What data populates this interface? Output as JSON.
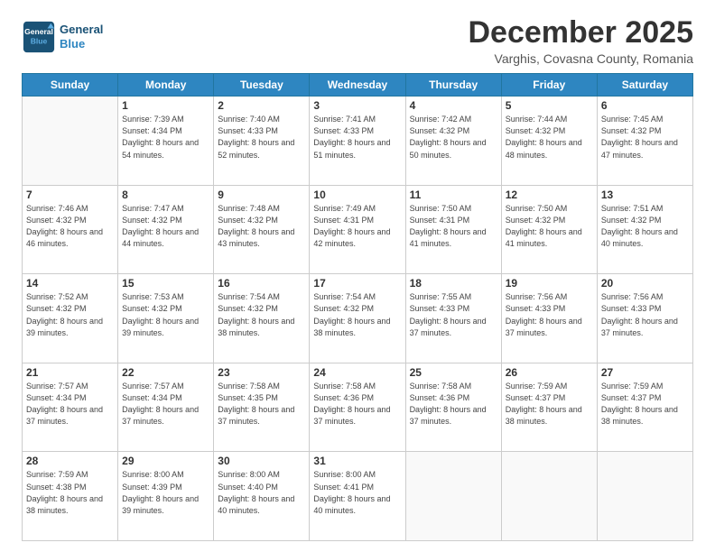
{
  "logo": {
    "line1": "General",
    "line2": "Blue"
  },
  "title": "December 2025",
  "subtitle": "Varghis, Covasna County, Romania",
  "days_of_week": [
    "Sunday",
    "Monday",
    "Tuesday",
    "Wednesday",
    "Thursday",
    "Friday",
    "Saturday"
  ],
  "weeks": [
    [
      {
        "day": "",
        "sunrise": "",
        "sunset": "",
        "daylight": ""
      },
      {
        "day": "1",
        "sunrise": "7:39 AM",
        "sunset": "4:34 PM",
        "daylight": "8 hours and 54 minutes."
      },
      {
        "day": "2",
        "sunrise": "7:40 AM",
        "sunset": "4:33 PM",
        "daylight": "8 hours and 52 minutes."
      },
      {
        "day": "3",
        "sunrise": "7:41 AM",
        "sunset": "4:33 PM",
        "daylight": "8 hours and 51 minutes."
      },
      {
        "day": "4",
        "sunrise": "7:42 AM",
        "sunset": "4:32 PM",
        "daylight": "8 hours and 50 minutes."
      },
      {
        "day": "5",
        "sunrise": "7:44 AM",
        "sunset": "4:32 PM",
        "daylight": "8 hours and 48 minutes."
      },
      {
        "day": "6",
        "sunrise": "7:45 AM",
        "sunset": "4:32 PM",
        "daylight": "8 hours and 47 minutes."
      }
    ],
    [
      {
        "day": "7",
        "sunrise": "7:46 AM",
        "sunset": "4:32 PM",
        "daylight": "8 hours and 46 minutes."
      },
      {
        "day": "8",
        "sunrise": "7:47 AM",
        "sunset": "4:32 PM",
        "daylight": "8 hours and 44 minutes."
      },
      {
        "day": "9",
        "sunrise": "7:48 AM",
        "sunset": "4:32 PM",
        "daylight": "8 hours and 43 minutes."
      },
      {
        "day": "10",
        "sunrise": "7:49 AM",
        "sunset": "4:31 PM",
        "daylight": "8 hours and 42 minutes."
      },
      {
        "day": "11",
        "sunrise": "7:50 AM",
        "sunset": "4:31 PM",
        "daylight": "8 hours and 41 minutes."
      },
      {
        "day": "12",
        "sunrise": "7:50 AM",
        "sunset": "4:32 PM",
        "daylight": "8 hours and 41 minutes."
      },
      {
        "day": "13",
        "sunrise": "7:51 AM",
        "sunset": "4:32 PM",
        "daylight": "8 hours and 40 minutes."
      }
    ],
    [
      {
        "day": "14",
        "sunrise": "7:52 AM",
        "sunset": "4:32 PM",
        "daylight": "8 hours and 39 minutes."
      },
      {
        "day": "15",
        "sunrise": "7:53 AM",
        "sunset": "4:32 PM",
        "daylight": "8 hours and 39 minutes."
      },
      {
        "day": "16",
        "sunrise": "7:54 AM",
        "sunset": "4:32 PM",
        "daylight": "8 hours and 38 minutes."
      },
      {
        "day": "17",
        "sunrise": "7:54 AM",
        "sunset": "4:32 PM",
        "daylight": "8 hours and 38 minutes."
      },
      {
        "day": "18",
        "sunrise": "7:55 AM",
        "sunset": "4:33 PM",
        "daylight": "8 hours and 37 minutes."
      },
      {
        "day": "19",
        "sunrise": "7:56 AM",
        "sunset": "4:33 PM",
        "daylight": "8 hours and 37 minutes."
      },
      {
        "day": "20",
        "sunrise": "7:56 AM",
        "sunset": "4:33 PM",
        "daylight": "8 hours and 37 minutes."
      }
    ],
    [
      {
        "day": "21",
        "sunrise": "7:57 AM",
        "sunset": "4:34 PM",
        "daylight": "8 hours and 37 minutes."
      },
      {
        "day": "22",
        "sunrise": "7:57 AM",
        "sunset": "4:34 PM",
        "daylight": "8 hours and 37 minutes."
      },
      {
        "day": "23",
        "sunrise": "7:58 AM",
        "sunset": "4:35 PM",
        "daylight": "8 hours and 37 minutes."
      },
      {
        "day": "24",
        "sunrise": "7:58 AM",
        "sunset": "4:36 PM",
        "daylight": "8 hours and 37 minutes."
      },
      {
        "day": "25",
        "sunrise": "7:58 AM",
        "sunset": "4:36 PM",
        "daylight": "8 hours and 37 minutes."
      },
      {
        "day": "26",
        "sunrise": "7:59 AM",
        "sunset": "4:37 PM",
        "daylight": "8 hours and 38 minutes."
      },
      {
        "day": "27",
        "sunrise": "7:59 AM",
        "sunset": "4:37 PM",
        "daylight": "8 hours and 38 minutes."
      }
    ],
    [
      {
        "day": "28",
        "sunrise": "7:59 AM",
        "sunset": "4:38 PM",
        "daylight": "8 hours and 38 minutes."
      },
      {
        "day": "29",
        "sunrise": "8:00 AM",
        "sunset": "4:39 PM",
        "daylight": "8 hours and 39 minutes."
      },
      {
        "day": "30",
        "sunrise": "8:00 AM",
        "sunset": "4:40 PM",
        "daylight": "8 hours and 40 minutes."
      },
      {
        "day": "31",
        "sunrise": "8:00 AM",
        "sunset": "4:41 PM",
        "daylight": "8 hours and 40 minutes."
      },
      {
        "day": "",
        "sunrise": "",
        "sunset": "",
        "daylight": ""
      },
      {
        "day": "",
        "sunrise": "",
        "sunset": "",
        "daylight": ""
      },
      {
        "day": "",
        "sunrise": "",
        "sunset": "",
        "daylight": ""
      }
    ]
  ]
}
